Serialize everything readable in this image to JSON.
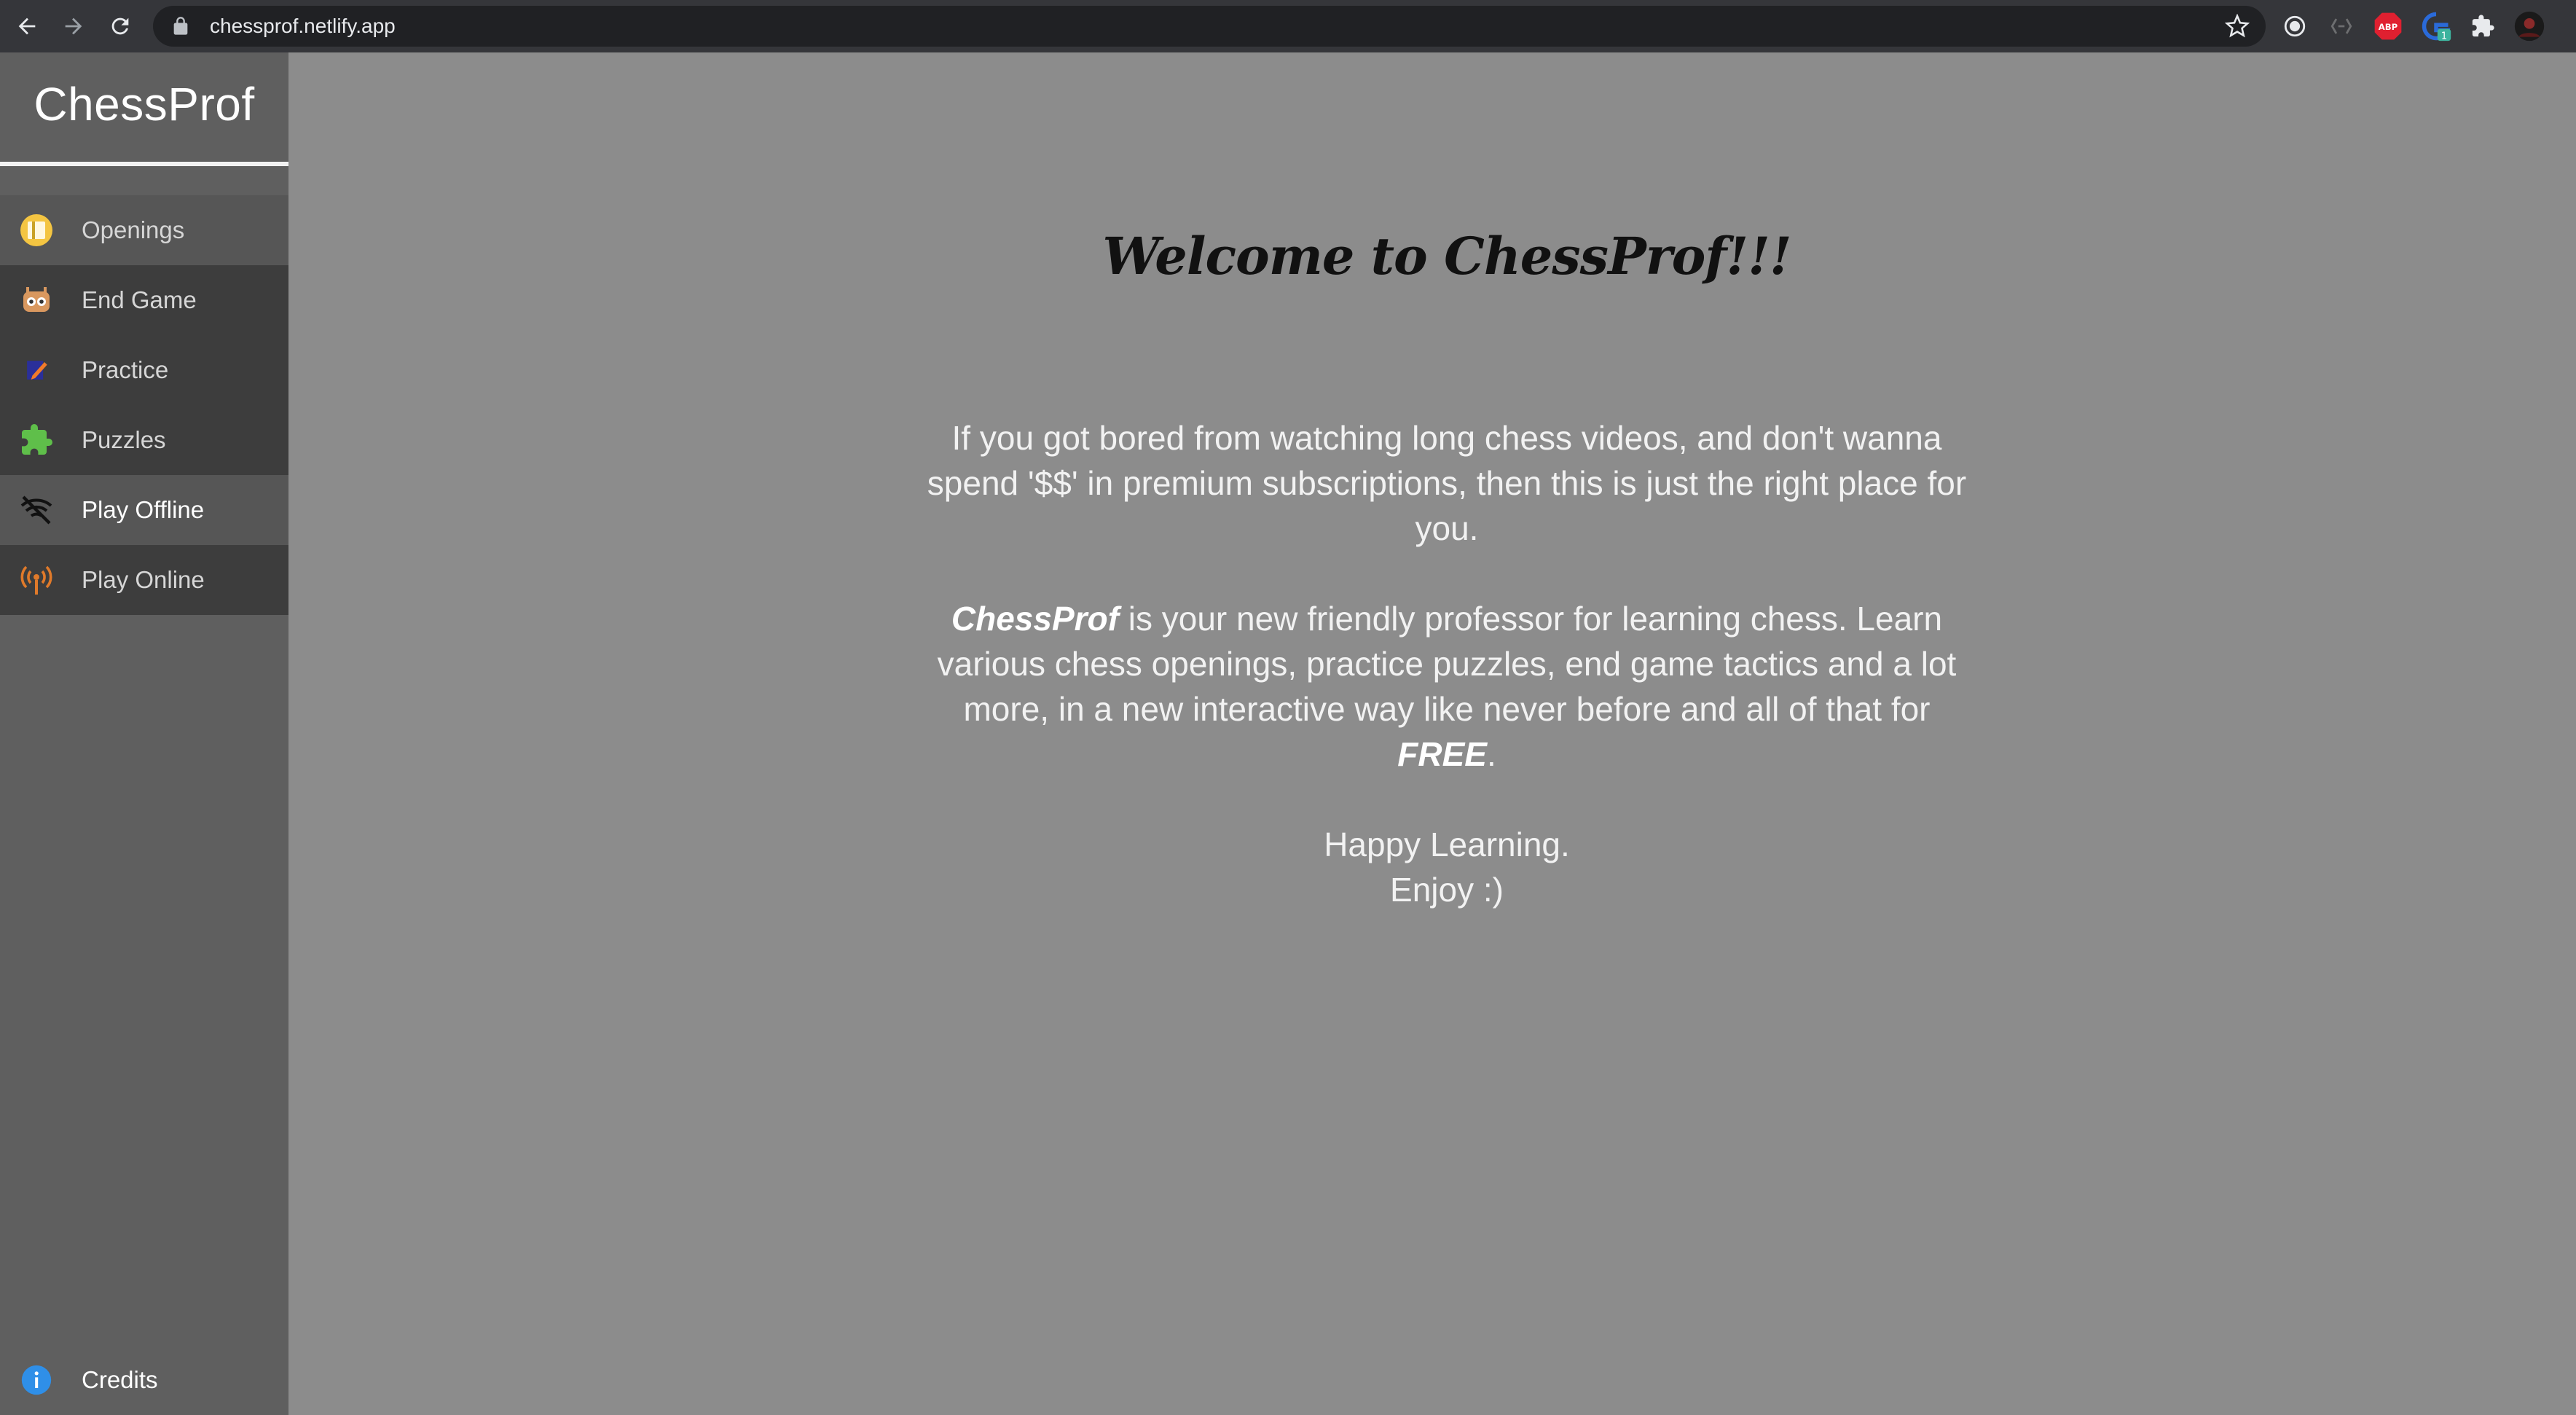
{
  "browser": {
    "url": "chessprof.netlify.app",
    "extension_badge": "ABP",
    "extension_count": "1"
  },
  "sidebar": {
    "brand": "ChessProf",
    "items": [
      {
        "label": "Openings",
        "icon": "book-icon"
      },
      {
        "label": "End Game",
        "icon": "robot-icon"
      },
      {
        "label": "Practice",
        "icon": "pencil-icon"
      },
      {
        "label": "Puzzles",
        "icon": "puzzle-icon"
      },
      {
        "label": "Play Offline",
        "icon": "wifi-off-icon"
      },
      {
        "label": "Play Online",
        "icon": "broadcast-icon"
      }
    ],
    "credits": "Credits"
  },
  "main": {
    "welcome": "Welcome to ChessProf!!!",
    "intro": "If you got bored from watching long chess videos, and don't wanna spend '$$' in premium subscriptions, then this is just the right place for you.",
    "para2_brand": "ChessProf",
    "para2_text": " is your new friendly professor for learning chess. Learn various chess openings, practice puzzles, end game tactics and a lot more, in a new interactive way like never before and all of that for ",
    "para2_free": "FREE",
    "para2_end": ".",
    "closing1": "Happy Learning.",
    "closing2": "Enjoy :)"
  },
  "colors": {
    "chrome": "#35363a",
    "sidebar": "#5f5f5f",
    "sidebar_dark": "#3d3d3d",
    "main_bg": "#8c8c8c"
  }
}
